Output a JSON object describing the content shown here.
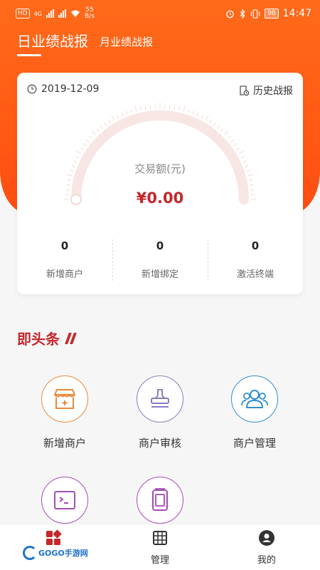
{
  "status_bar": {
    "time": "14:47",
    "battery": "98",
    "net_speed_value": "55",
    "net_speed_unit": "B/s",
    "hd_label": "HD",
    "sig_label": "4G"
  },
  "tabs": [
    {
      "label": "日业绩战报",
      "active": true
    },
    {
      "label": "月业绩战报",
      "active": false
    }
  ],
  "report_card": {
    "date": "2019-12-09",
    "history_label": "历史战报",
    "gauge_label": "交易额(元)",
    "gauge_value": "¥0.00",
    "stats": [
      {
        "value": "0",
        "label": "新增商户"
      },
      {
        "value": "0",
        "label": "新增绑定"
      },
      {
        "value": "0",
        "label": "激活终端"
      }
    ]
  },
  "news": {
    "title": "即头条"
  },
  "grid": [
    {
      "label": "新增商户",
      "icon": "add-merchant-icon",
      "color": "#e88a3a"
    },
    {
      "label": "商户审核",
      "icon": "stamp-icon",
      "color": "#8c7bbf"
    },
    {
      "label": "商户管理",
      "icon": "users-icon",
      "color": "#2f8fd1"
    },
    {
      "label": "",
      "icon": "terminal-icon",
      "color": "#a34fb3"
    },
    {
      "label": "",
      "icon": "device-icon",
      "color": "#a34fb3"
    }
  ],
  "tabbar": [
    {
      "label": "",
      "icon": "home-grid-icon"
    },
    {
      "label": "管理",
      "icon": "calculator-icon"
    },
    {
      "label": "我的",
      "icon": "profile-icon"
    }
  ],
  "watermark": {
    "text": "GOGO手游网"
  },
  "colors": {
    "header": "#ff5a14",
    "accent": "#c4272c"
  }
}
